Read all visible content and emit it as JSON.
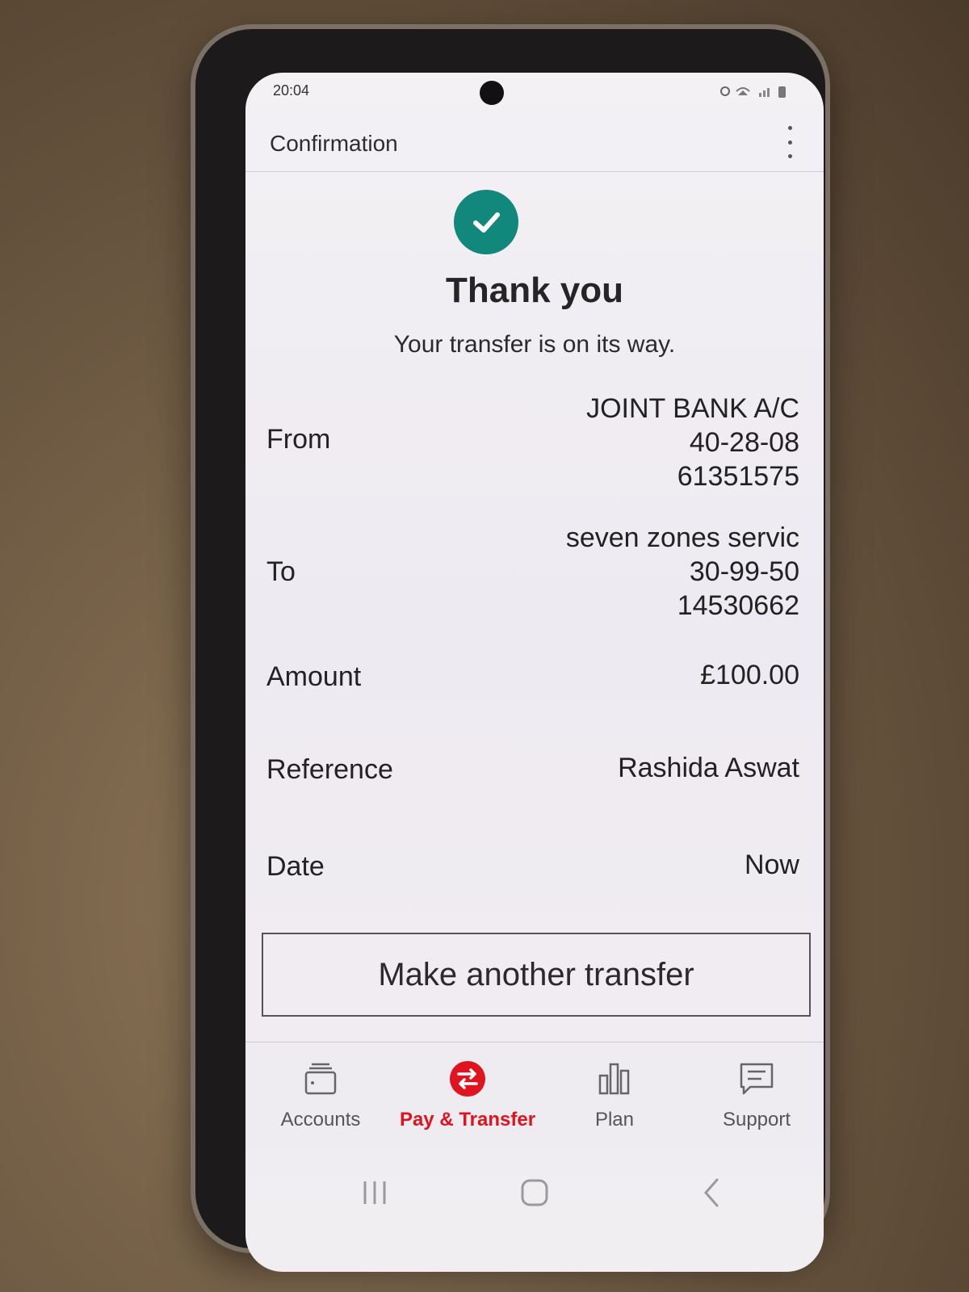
{
  "status_bar": {
    "time": "20:04"
  },
  "app_bar": {
    "title": "Confirmation"
  },
  "confirmation": {
    "heading": "Thank you",
    "message": "Your transfer is on its way."
  },
  "details": {
    "from": {
      "label": "From",
      "line1": "JOINT BANK A/C",
      "line2": "40-28-08",
      "line3": "61351575"
    },
    "to": {
      "label": "To",
      "line1": "seven zones servic",
      "line2": "30-99-50",
      "line3": "14530662"
    },
    "amount": {
      "label": "Amount",
      "value": "£100.00"
    },
    "reference": {
      "label": "Reference",
      "value": "Rashida Aswat"
    },
    "date": {
      "label": "Date",
      "value": "Now"
    }
  },
  "actions": {
    "make_another_label": "Make another transfer"
  },
  "bottom_nav": {
    "items": [
      {
        "label": "Accounts",
        "icon": "wallet-icon"
      },
      {
        "label": "Pay & Transfer",
        "icon": "transfer-icon",
        "active": true
      },
      {
        "label": "Plan",
        "icon": "bar-chart-icon"
      },
      {
        "label": "Support",
        "icon": "chat-icon"
      }
    ]
  },
  "colors": {
    "accent": "#e0141e",
    "success": "#12877c"
  }
}
